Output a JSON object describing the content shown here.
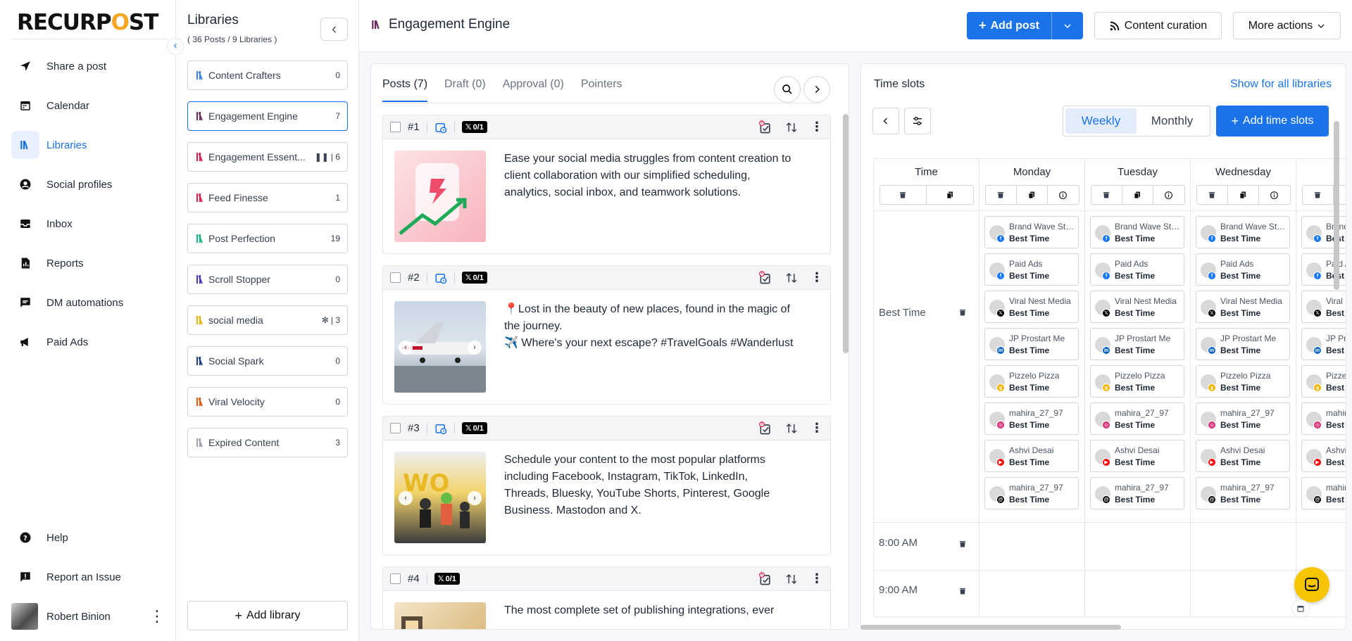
{
  "brand": {
    "logo_part1": "RECURP",
    "logo_o": "O",
    "logo_part2": "ST"
  },
  "nav": {
    "items": [
      {
        "label": "Share a post",
        "icon": "send-icon"
      },
      {
        "label": "Calendar",
        "icon": "calendar-icon"
      },
      {
        "label": "Libraries",
        "icon": "library-icon",
        "active": true
      },
      {
        "label": "Social profiles",
        "icon": "user-circle-icon"
      },
      {
        "label": "Inbox",
        "icon": "inbox-icon"
      },
      {
        "label": "Reports",
        "icon": "report-icon"
      },
      {
        "label": "DM automations",
        "icon": "chat-icon"
      },
      {
        "label": "Paid Ads",
        "icon": "megaphone-icon"
      }
    ],
    "bottom": [
      {
        "label": "Help",
        "icon": "help-icon"
      },
      {
        "label": "Report an Issue",
        "icon": "report-issue-icon"
      }
    ],
    "user_name": "Robert Binion"
  },
  "libraries": {
    "title": "Libraries",
    "subtitle": "( 36 Posts / 9 Libraries )",
    "items": [
      {
        "name": "Content Crafters",
        "count": "0",
        "color": "#3b82f6"
      },
      {
        "name": "Engagement Engine",
        "count": "7",
        "color": "#6b2a5e",
        "active": true
      },
      {
        "name": "Engagement Essent...",
        "count": "6",
        "color": "#e11d48",
        "paused": true
      },
      {
        "name": "Feed Finesse",
        "count": "1",
        "color": "#e11d48"
      },
      {
        "name": "Post Perfection",
        "count": "19",
        "color": "#10b981"
      },
      {
        "name": "Scroll Stopper",
        "count": "0",
        "color": "#4338ca"
      },
      {
        "name": "social media",
        "count": "3",
        "color": "#eab308",
        "snow": true
      },
      {
        "name": "Social Spark",
        "count": "0",
        "color": "#1e3a8a"
      },
      {
        "name": "Viral Velocity",
        "count": "0",
        "color": "#ea580c"
      },
      {
        "name": "Expired Content",
        "count": "3",
        "color": "#9ca3af"
      }
    ],
    "add_label": "Add library"
  },
  "header": {
    "title": "Engagement Engine",
    "add_post": "Add post",
    "content_curation": "Content curation",
    "more_actions": "More actions"
  },
  "posts": {
    "tabs": [
      "Posts (7)",
      "Draft (0)",
      "Approval (0)",
      "Pointers"
    ],
    "items": [
      {
        "num": "#1",
        "x_count": "0/1",
        "text_lines": [
          "Ease your social media struggles from content creation to",
          "client collaboration with our simplified scheduling,",
          "analytics, social inbox, and teamwork solutions."
        ]
      },
      {
        "num": "#2",
        "x_count": "0/1",
        "text_lines": [
          "📍Lost in the beauty of new places, found in the magic of",
          "the journey.",
          "✈️ Where's your next escape? #TravelGoals #Wanderlust"
        ]
      },
      {
        "num": "#3",
        "x_count": "0/1",
        "text_lines": [
          "Schedule your content to the most popular platforms",
          "including Facebook, Instagram, TikTok, LinkedIn,",
          "Threads, Bluesky, YouTube Shorts, Pinterest, Google",
          "Business. Mastodon and X."
        ]
      },
      {
        "num": "#4",
        "x_count": "0/1",
        "text_lines": [
          "The most complete set of publishing integrations, ever"
        ]
      }
    ]
  },
  "timeslots": {
    "title": "Time slots",
    "show_all": "Show for all libraries",
    "view_weekly": "Weekly",
    "view_monthly": "Monthly",
    "add_label": "Add time slots",
    "columns": [
      "Time",
      "Monday",
      "Tuesday",
      "Wednesday",
      "T"
    ],
    "rows": [
      "Best Time",
      "8:00 AM",
      "9:00 AM"
    ],
    "accounts": [
      {
        "name": "Brand Wave Stu...",
        "slot": "Best Time",
        "network": "facebook",
        "color": "#1877f2"
      },
      {
        "name": "Paid Ads",
        "slot": "Best Time",
        "network": "facebook",
        "color": "#1877f2"
      },
      {
        "name": "Viral Nest Media",
        "slot": "Best Time",
        "network": "x",
        "color": "#000000"
      },
      {
        "name": "JP Prostart Me",
        "slot": "Best Time",
        "network": "linkedin",
        "color": "#0a66c2"
      },
      {
        "name": "Pizzelo Pizza",
        "slot": "Best Time",
        "network": "google-business",
        "color": "#f4b400"
      },
      {
        "name": "mahira_27_97",
        "slot": "Best Time",
        "network": "instagram",
        "color": "#d62976"
      },
      {
        "name": "Ashvi Desai",
        "slot": "Best Time",
        "network": "youtube",
        "color": "#ff0000"
      },
      {
        "name": "mahira_27_97",
        "slot": "Best Time",
        "network": "threads",
        "color": "#000000"
      }
    ]
  }
}
